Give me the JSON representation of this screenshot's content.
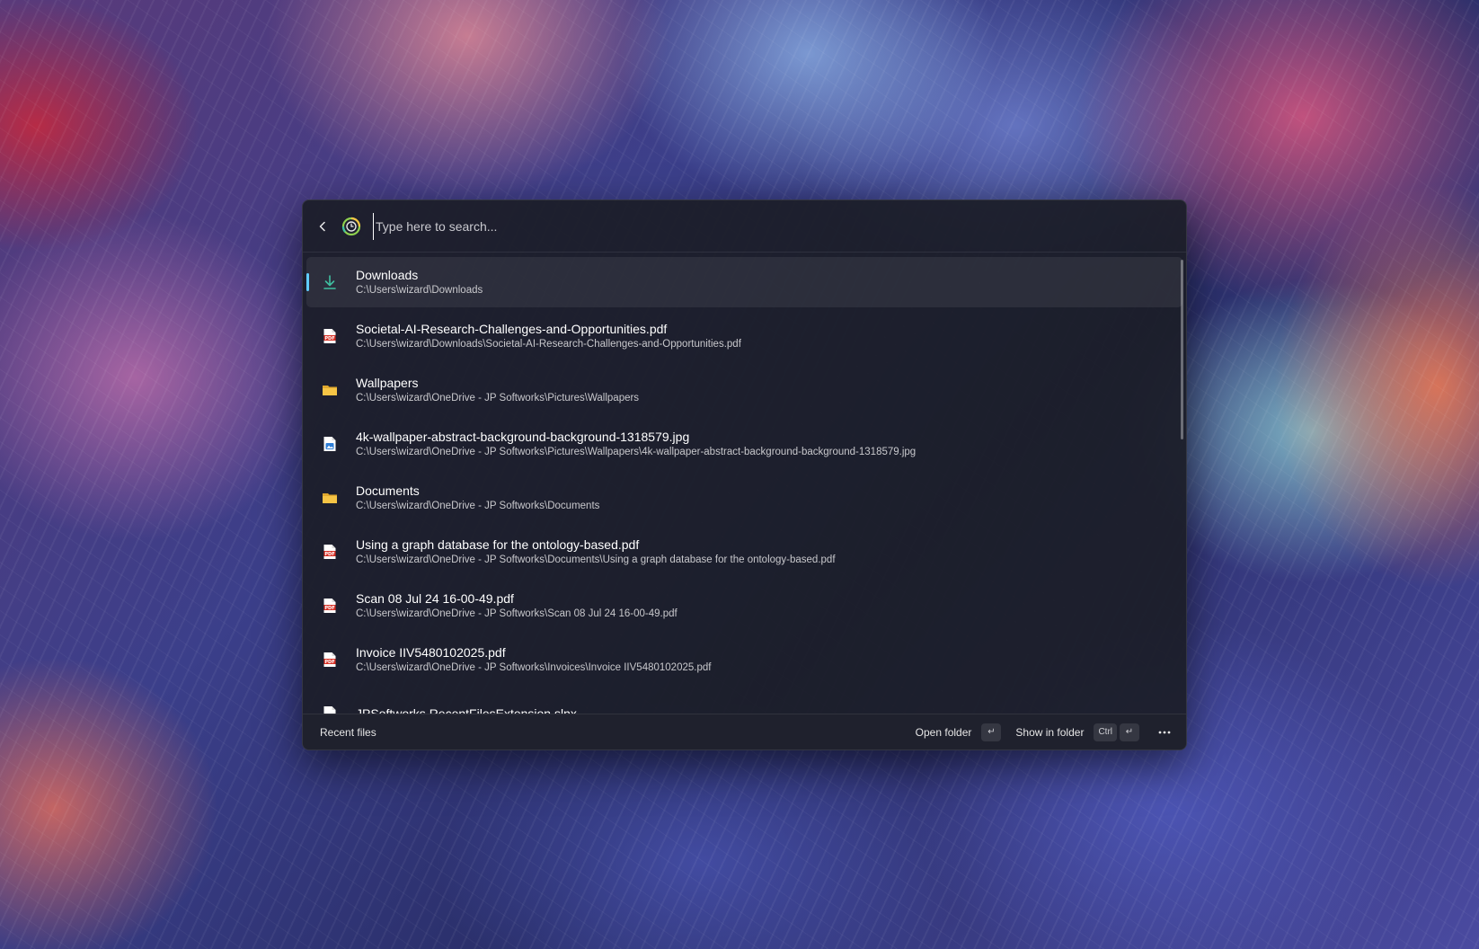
{
  "search": {
    "placeholder": "Type here to search..."
  },
  "results": [
    {
      "title": "Downloads",
      "path": "C:\\Users\\wizard\\Downloads",
      "icon": "download-icon",
      "selected": true
    },
    {
      "title": "Societal-AI-Research-Challenges-and-Opportunities.pdf",
      "path": "C:\\Users\\wizard\\Downloads\\Societal-AI-Research-Challenges-and-Opportunities.pdf",
      "icon": "pdf-file-icon"
    },
    {
      "title": "Wallpapers",
      "path": "C:\\Users\\wizard\\OneDrive - JP Softworks\\Pictures\\Wallpapers",
      "icon": "folder-icon"
    },
    {
      "title": "4k-wallpaper-abstract-background-background-1318579.jpg",
      "path": "C:\\Users\\wizard\\OneDrive - JP Softworks\\Pictures\\Wallpapers\\4k-wallpaper-abstract-background-background-1318579.jpg",
      "icon": "image-file-icon"
    },
    {
      "title": "Documents",
      "path": "C:\\Users\\wizard\\OneDrive - JP Softworks\\Documents",
      "icon": "folder-icon"
    },
    {
      "title": "Using a graph database for the ontology-based.pdf",
      "path": "C:\\Users\\wizard\\OneDrive - JP Softworks\\Documents\\Using a graph database for the ontology-based.pdf",
      "icon": "pdf-file-icon"
    },
    {
      "title": "Scan 08 Jul 24 16-00-49.pdf",
      "path": "C:\\Users\\wizard\\OneDrive - JP Softworks\\Scan 08 Jul 24 16-00-49.pdf",
      "icon": "pdf-file-icon"
    },
    {
      "title": "Invoice IIV5480102025.pdf",
      "path": "C:\\Users\\wizard\\OneDrive - JP Softworks\\Invoices\\Invoice IIV5480102025.pdf",
      "icon": "pdf-file-icon"
    },
    {
      "title": "JPSoftworks.RecentFilesExtension.slnx",
      "path": "",
      "icon": "generic-file-icon"
    }
  ],
  "footer": {
    "title": "Recent files",
    "open_folder_label": "Open folder",
    "open_folder_key": "↵",
    "show_in_folder_label": "Show in folder",
    "show_in_folder_key_mod": "Ctrl",
    "show_in_folder_key": "↵"
  },
  "colors": {
    "accent": "#60cdff",
    "pdf_red": "#d93025",
    "folder_yellow": "#f6c445",
    "download_green": "#3fbfa0"
  }
}
